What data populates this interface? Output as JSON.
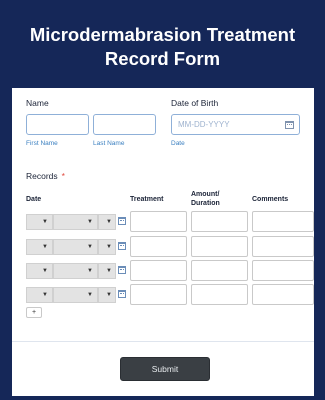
{
  "form": {
    "title": "Microdermabrasion Treatment Record Form"
  },
  "name": {
    "label": "Name",
    "first_sublabel": "First Name",
    "last_sublabel": "Last Name",
    "first_value": "",
    "last_value": ""
  },
  "dob": {
    "label": "Date of Birth",
    "placeholder": "MM-DD-YYYY",
    "sublabel": "Date",
    "icon": "calendar-icon"
  },
  "records": {
    "label": "Records",
    "required_marker": "*",
    "columns": [
      "Date",
      "Treatment",
      "Amount/ Duration",
      "Comments"
    ],
    "rows": [
      {
        "month": "",
        "day": "",
        "year": "",
        "treatment": "",
        "amount": "",
        "comments": ""
      },
      {
        "month": "",
        "day": "",
        "year": "",
        "treatment": "",
        "amount": "",
        "comments": ""
      },
      {
        "month": "",
        "day": "",
        "year": "",
        "treatment": "",
        "amount": "",
        "comments": ""
      },
      {
        "month": "",
        "day": "",
        "year": "",
        "treatment": "",
        "amount": "",
        "comments": ""
      }
    ],
    "dropdown_arrow": "▼",
    "add_row_label": "+"
  },
  "submit": {
    "label": "Submit"
  },
  "colors": {
    "background": "#152758",
    "card": "#ffffff",
    "accent": "#3a7fc0",
    "required": "#e0463b",
    "submit_button": "#3a3f44"
  }
}
